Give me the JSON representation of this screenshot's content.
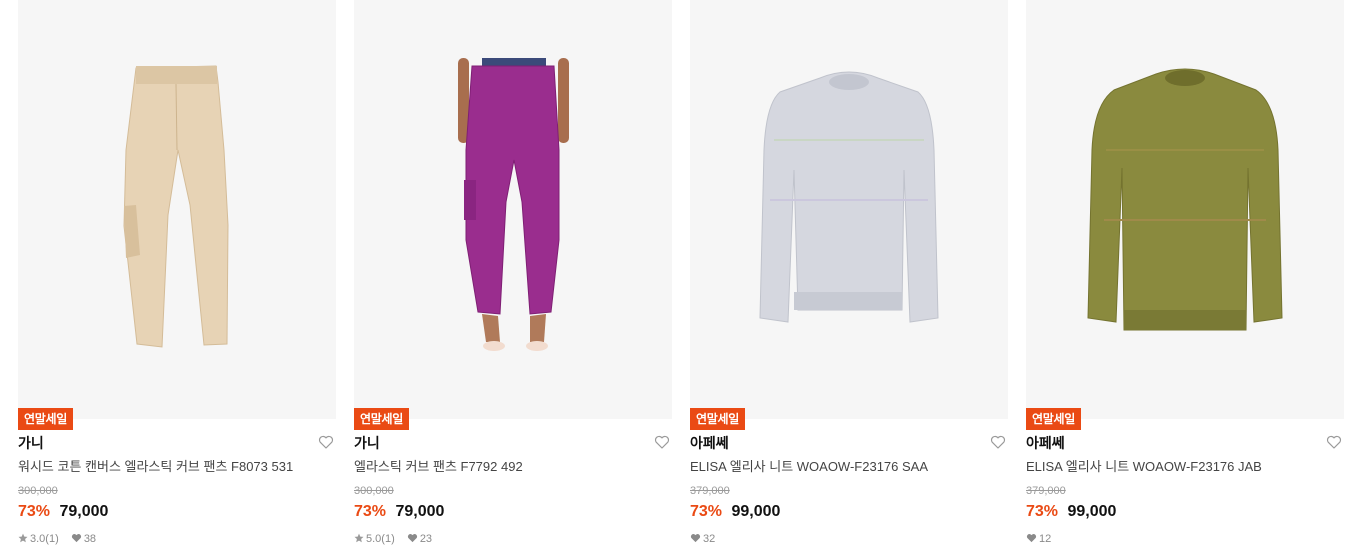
{
  "products": [
    {
      "badge": "연말세일",
      "brand": "가니",
      "name": "워시드 코튼 캔버스 엘라스틱 커브 팬츠 F8073 531",
      "original_price": "300,000",
      "discount": "73%",
      "price": "79,000",
      "rating": "3.0",
      "review_count": "(1)",
      "likes": "38",
      "image_icon": "beige-cargo-pants-image"
    },
    {
      "badge": "연말세일",
      "brand": "가니",
      "name": "엘라스틱 커브 팬츠 F7792 492",
      "original_price": "300,000",
      "discount": "73%",
      "price": "79,000",
      "rating": "5.0",
      "review_count": "(1)",
      "likes": "23",
      "image_icon": "purple-pants-image"
    },
    {
      "badge": "연말세일",
      "brand": "아페쎄",
      "name": "ELISA 엘리사 니트 WOAOW-F23176 SAA",
      "original_price": "379,000",
      "discount": "73%",
      "price": "99,000",
      "likes": "32",
      "image_icon": "grey-knit-sweater-image"
    },
    {
      "badge": "연말세일",
      "brand": "아페쎄",
      "name": "ELISA 엘리사 니트 WOAOW-F23176 JAB",
      "original_price": "379,000",
      "discount": "73%",
      "price": "99,000",
      "likes": "12",
      "image_icon": "olive-knit-sweater-image"
    }
  ],
  "colors": {
    "accent": "#ea4a14",
    "image_bg": "#f6f6f6",
    "meta_gray": "#8a8a8a"
  }
}
